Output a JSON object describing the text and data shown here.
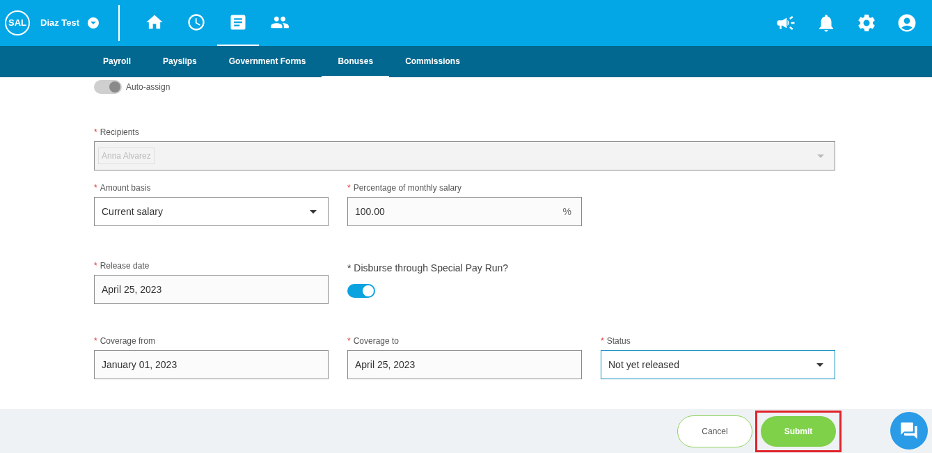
{
  "header": {
    "logo": "SAL",
    "company": "Diaz Test",
    "nav": [
      {
        "kind": "home",
        "selected": false
      },
      {
        "kind": "clock",
        "selected": false
      },
      {
        "kind": "document",
        "selected": true
      },
      {
        "kind": "people",
        "selected": false
      }
    ]
  },
  "tabs": [
    {
      "label": "Payroll",
      "selected": false
    },
    {
      "label": "Payslips",
      "selected": false
    },
    {
      "label": "Government Forms",
      "selected": false
    },
    {
      "label": "Bonuses",
      "selected": true
    },
    {
      "label": "Commissions",
      "selected": false
    }
  ],
  "auto_assign": {
    "label": "Auto-assign",
    "on": true,
    "disabled": true
  },
  "recipients": {
    "label": "Recipients",
    "required": "*",
    "disabled": true,
    "tags": [
      "Anna Alvarez"
    ]
  },
  "row1": [
    {
      "kind": "select",
      "label": "Amount basis",
      "required": "*",
      "value": "Current salary"
    },
    {
      "kind": "text",
      "label": "Percentage of monthly salary",
      "required": "*",
      "value": "100.00",
      "suffix": "%"
    }
  ],
  "row2": [
    {
      "kind": "text",
      "label": "Release date",
      "required": "*",
      "value": "April 25, 2023"
    },
    {
      "kind": "toggle",
      "label": "* Disburse through Special Pay Run?",
      "on": true
    }
  ],
  "row3": [
    {
      "kind": "text",
      "label": "Coverage from",
      "required": "*",
      "value": "January 01, 2023"
    },
    {
      "kind": "text",
      "label": "Coverage to",
      "required": "*",
      "value": "April 25, 2023"
    },
    {
      "kind": "select",
      "label": "Status",
      "required": "*",
      "value": "Not yet released",
      "focused": true
    }
  ],
  "footer": {
    "cancel": "Cancel",
    "submit": "Submit",
    "submit_highlighted": true
  }
}
